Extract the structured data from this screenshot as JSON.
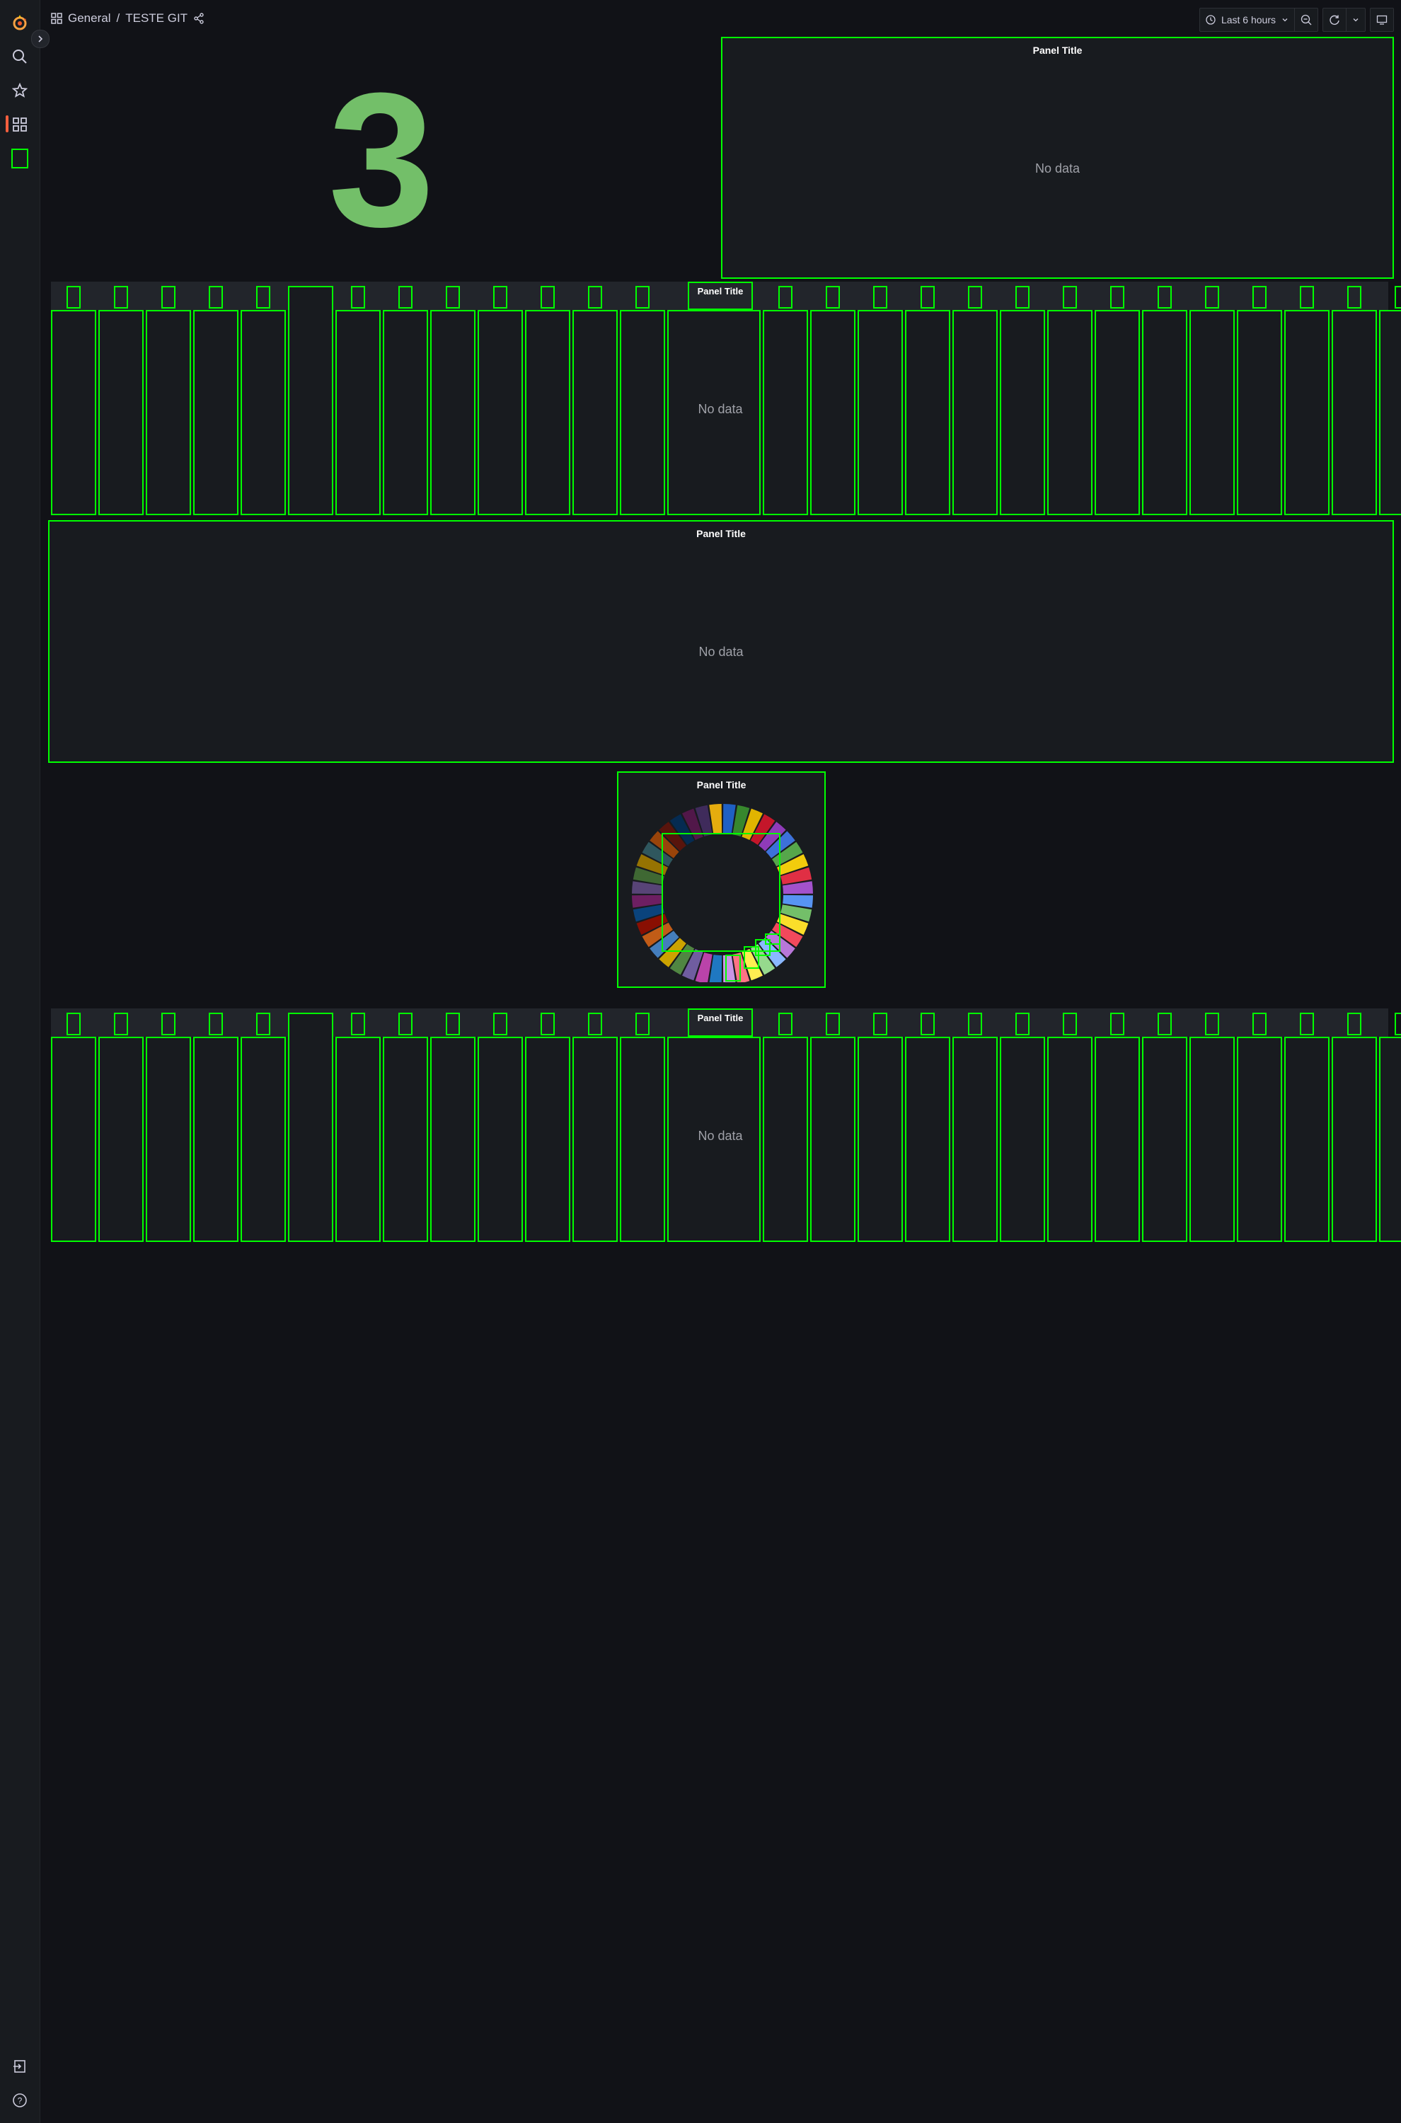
{
  "breadcrumb": {
    "folder": "General",
    "separator": "/",
    "dashboard": "TESTE GIT"
  },
  "toolbar": {
    "time_range": "Last 6 hours"
  },
  "panels": {
    "stat": {
      "value": "3"
    },
    "top_right": {
      "title": "Panel Title",
      "empty": "No data"
    },
    "strip1": {
      "title": "Panel Title",
      "empty": "No data"
    },
    "wide": {
      "title": "Panel Title",
      "empty": "No data"
    },
    "pie": {
      "title": "Panel Title"
    },
    "strip2": {
      "title": "Panel Title",
      "empty": "No data"
    }
  },
  "colors": {
    "accent": "#f55f3e",
    "highlight": "#00ff00",
    "stat": "#73bf69"
  },
  "pie_colors": [
    "#1f60c4",
    "#37872d",
    "#e0b400",
    "#c4162a",
    "#8f3bb8",
    "#3d71d9",
    "#56a64b",
    "#f2cc0c",
    "#e02f44",
    "#a352cc",
    "#5794f2",
    "#73bf69",
    "#fade2a",
    "#f2495c",
    "#b877d9",
    "#8ab8ff",
    "#96d98d",
    "#ffee52",
    "#ff7383",
    "#ca95e5",
    "#1f78c1",
    "#ba43a9",
    "#705da0",
    "#508642",
    "#cca300",
    "#447ebc",
    "#c15c17",
    "#890f02",
    "#0a437c",
    "#6d1f62",
    "#584477",
    "#3f6833",
    "#967302",
    "#2f575e",
    "#99440a",
    "#58140c",
    "#052b51",
    "#511749",
    "#3f2b5b",
    "#e5ac0e"
  ]
}
